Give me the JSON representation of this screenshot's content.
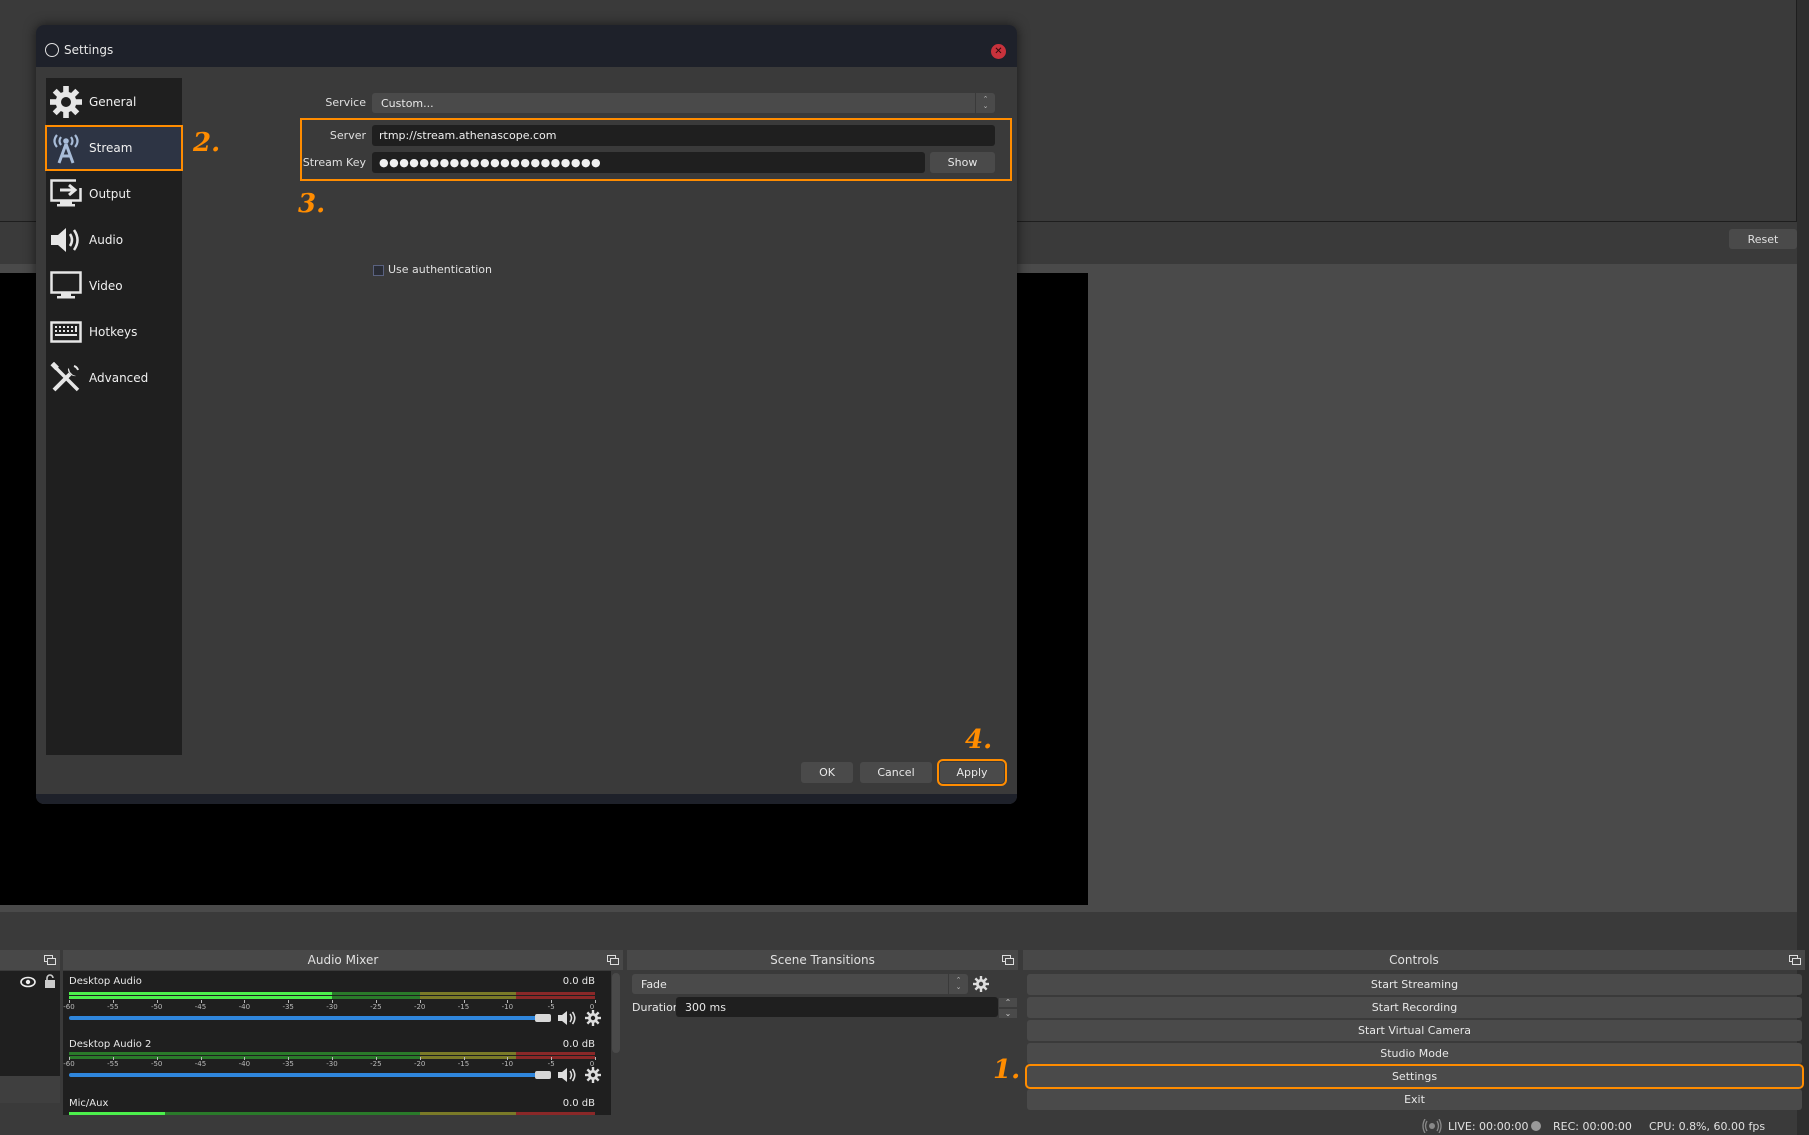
{
  "background": {
    "reset_button": "Reset"
  },
  "dialog": {
    "title": "Settings",
    "sidebar": {
      "items": [
        {
          "label": "General",
          "icon": "gear-icon"
        },
        {
          "label": "Stream",
          "icon": "antenna-icon",
          "active": true
        },
        {
          "label": "Output",
          "icon": "output-icon"
        },
        {
          "label": "Audio",
          "icon": "speaker-icon"
        },
        {
          "label": "Video",
          "icon": "monitor-icon"
        },
        {
          "label": "Hotkeys",
          "icon": "keyboard-icon"
        },
        {
          "label": "Advanced",
          "icon": "tools-icon"
        }
      ]
    },
    "stream": {
      "service_label": "Service",
      "service_value": "Custom...",
      "server_label": "Server",
      "server_value": "rtmp://stream.athenascope.com",
      "stream_key_label": "Stream Key",
      "stream_key_value": "●●●●●●●●●●●●●●●●●●●●●●",
      "show_button": "Show",
      "use_auth_label": "Use authentication",
      "use_auth_checked": false
    },
    "buttons": {
      "ok": "OK",
      "cancel": "Cancel",
      "apply": "Apply"
    }
  },
  "annotations": {
    "step1": "1.",
    "step2": "2.",
    "step3": "3.",
    "step4": "4.",
    "color": "#ff8c00"
  },
  "audio_mixer": {
    "title": "Audio Mixer",
    "channels": [
      {
        "name": "Desktop Audio",
        "db": "0.0 dB",
        "volume_fraction": 1.0,
        "level_db": -30
      },
      {
        "name": "Desktop Audio 2",
        "db": "0.0 dB",
        "volume_fraction": 1.0,
        "level_db": -60
      },
      {
        "name": "Mic/Aux",
        "db": "0.0 dB",
        "level_db": -49
      }
    ],
    "tick_labels": [
      "-60",
      "-55",
      "-50",
      "-45",
      "-40",
      "-35",
      "-30",
      "-25",
      "-20",
      "-15",
      "-10",
      "-5",
      "0"
    ]
  },
  "scene_transitions": {
    "title": "Scene Transitions",
    "transition": "Fade",
    "duration_label": "Duration",
    "duration_value": "300 ms"
  },
  "controls": {
    "title": "Controls",
    "buttons": [
      "Start Streaming",
      "Start Recording",
      "Start Virtual Camera",
      "Studio Mode",
      "Settings",
      "Exit"
    ],
    "highlighted": "Settings"
  },
  "status_bar": {
    "live": "LIVE: 00:00:00",
    "rec": "REC: 00:00:00",
    "cpu": "CPU: 0.8%, 60.00 fps"
  }
}
